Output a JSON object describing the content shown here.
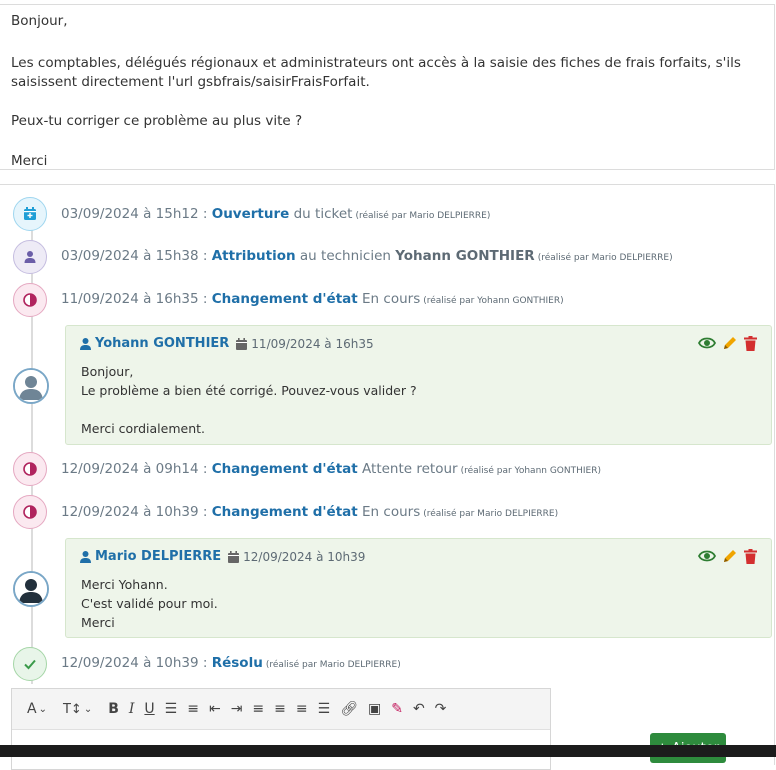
{
  "message": {
    "lines": [
      "Bonjour,",
      "Les comptables, délégués régionaux et administrateurs ont accès à la saisie des fiches de frais forfaits, s'ils",
      "saisissent directement l'url gsbfrais/saisirFraisForfait.",
      "Peux-tu corriger ce problème au plus vite ?",
      "Merci"
    ]
  },
  "events": [
    {
      "date": "03/09/2024 à 15h12",
      "sep": " : ",
      "action": "Ouverture",
      "rest": " du ticket",
      "by": "(réalisé par Mario DELPIERRE)",
      "icon": "calendar-plus-icon",
      "color": "#1f9ed6"
    },
    {
      "date": "03/09/2024 à 15h38",
      "sep": " : ",
      "action": "Attribution",
      "rest": " au technicien ",
      "strong": "Yohann GONTHIER",
      "by": "(réalisé par Mario DELPIERRE)",
      "icon": "user-icon",
      "color": "#6b5ea8"
    },
    {
      "date": "11/09/2024 à 16h35",
      "sep": " : ",
      "action": "Changement d'état",
      "rest": " En cours",
      "by": "(réalisé par Yohann GONTHIER)",
      "icon": "half-circle-icon",
      "color": "#b0245e"
    },
    {
      "date": "12/09/2024 à 09h14",
      "sep": " : ",
      "action": "Changement d'état",
      "rest": " Attente retour",
      "by": "(réalisé par Yohann GONTHIER)",
      "icon": "half-circle-icon",
      "color": "#b0245e"
    },
    {
      "date": "12/09/2024 à 10h39",
      "sep": " : ",
      "action": "Changement d'état",
      "rest": " En cours",
      "by": "(réalisé par Mario DELPIERRE)",
      "icon": "half-circle-icon",
      "color": "#b0245e"
    },
    {
      "date": "12/09/2024 à 10h39",
      "sep": " : ",
      "action": "Résolu",
      "rest": "",
      "by": "(réalisé par Mario DELPIERRE)",
      "icon": "check-icon",
      "color": "#3a9a4a"
    }
  ],
  "comments": [
    {
      "author": "Yohann GONTHIER",
      "date": "11/09/2024 à 16h35",
      "lines": [
        "Bonjour,",
        "Le problème a bien été corrigé. Pouvez-vous valider ?",
        "Merci cordialement."
      ]
    },
    {
      "author": "Mario DELPIERRE",
      "date": "12/09/2024 à 10h39",
      "lines": [
        "Merci Yohann.",
        "C'est validé pour moi.",
        "Merci"
      ]
    }
  ],
  "editor": {
    "add_label": "+ Ajouter"
  },
  "colors": {
    "link": "#1f6fa8",
    "accent_green": "#2e8b3d",
    "comment_bg": "#eef5ea"
  }
}
